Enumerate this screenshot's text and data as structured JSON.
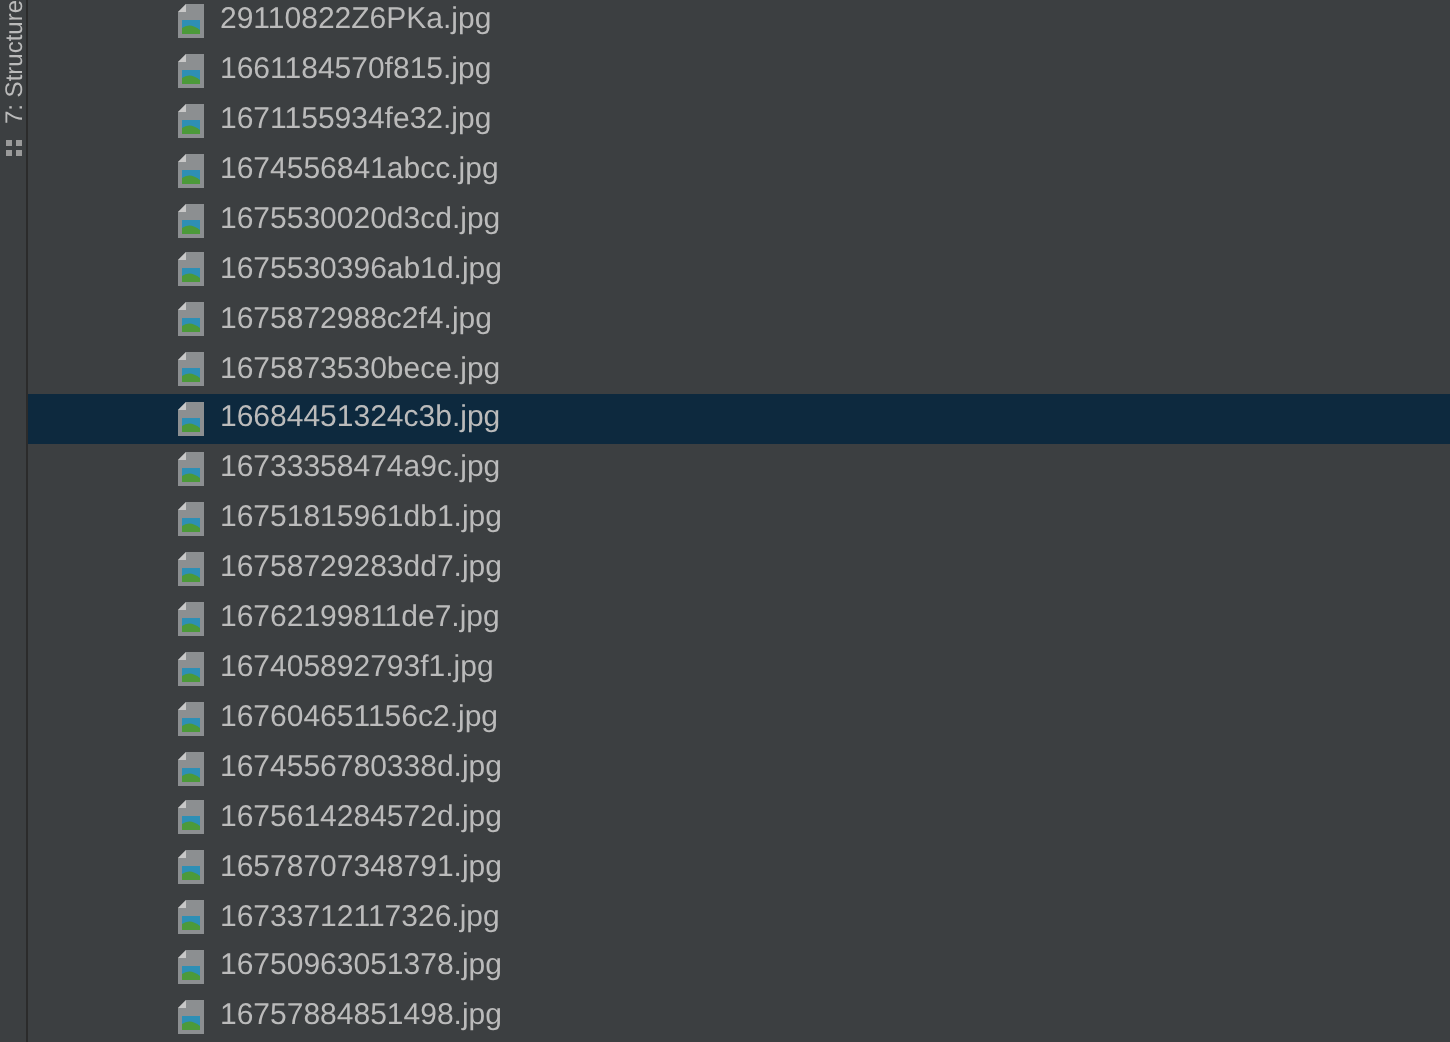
{
  "side_bar": {
    "tool_window_tab": "7: Structure"
  },
  "files": [
    {
      "name": "29110822Z6PKa.jpg",
      "selected": false
    },
    {
      "name": "1661184570f815.jpg",
      "selected": false
    },
    {
      "name": "1671155934fe32.jpg",
      "selected": false
    },
    {
      "name": "1674556841abcc.jpg",
      "selected": false
    },
    {
      "name": "1675530020d3cd.jpg",
      "selected": false
    },
    {
      "name": "1675530396ab1d.jpg",
      "selected": false
    },
    {
      "name": "1675872988c2f4.jpg",
      "selected": false
    },
    {
      "name": "1675873530bece.jpg",
      "selected": false
    },
    {
      "name": "16684451324c3b.jpg",
      "selected": true
    },
    {
      "name": "16733358474a9c.jpg",
      "selected": false
    },
    {
      "name": "16751815961db1.jpg",
      "selected": false
    },
    {
      "name": "16758729283dd7.jpg",
      "selected": false
    },
    {
      "name": "16762199811de7.jpg",
      "selected": false
    },
    {
      "name": "167405892793f1.jpg",
      "selected": false
    },
    {
      "name": "167604651156c2.jpg",
      "selected": false
    },
    {
      "name": "1674556780338d.jpg",
      "selected": false
    },
    {
      "name": "1675614284572d.jpg",
      "selected": false
    },
    {
      "name": "16578707348791.jpg",
      "selected": false
    },
    {
      "name": "16733712117326.jpg",
      "selected": false
    },
    {
      "name": "16750963051378.jpg",
      "selected": false
    },
    {
      "name": "16757884851498.jpg",
      "selected": false
    }
  ]
}
